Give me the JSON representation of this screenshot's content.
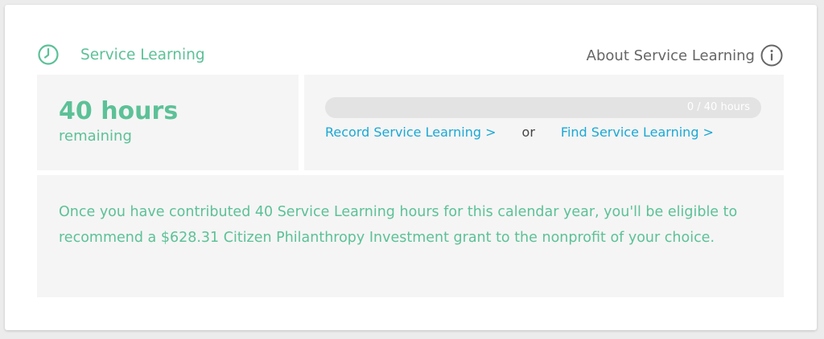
{
  "header": {
    "title": "Service Learning",
    "about_label": "About Service Learning",
    "clock_icon": "clock-icon",
    "info_icon": "info-icon"
  },
  "summary": {
    "hours": "40 hours",
    "sub": "remaining"
  },
  "progress": {
    "label": "0 / 40 hours",
    "completed_hours": 0,
    "goal_hours": 40
  },
  "links": {
    "record": "Record Service Learning >",
    "or": "or",
    "find": "Find Service Learning >"
  },
  "description": "Once you have contributed 40 Service Learning hours for this calendar year, you'll be eligible to recommend a $628.31 Citizen Philanthropy Investment grant to the nonprofit of your choice.",
  "colors": {
    "accent": "#5cc197",
    "link": "#1ba8d6",
    "panel": "#f5f5f5",
    "track": "#e3e3e3"
  }
}
